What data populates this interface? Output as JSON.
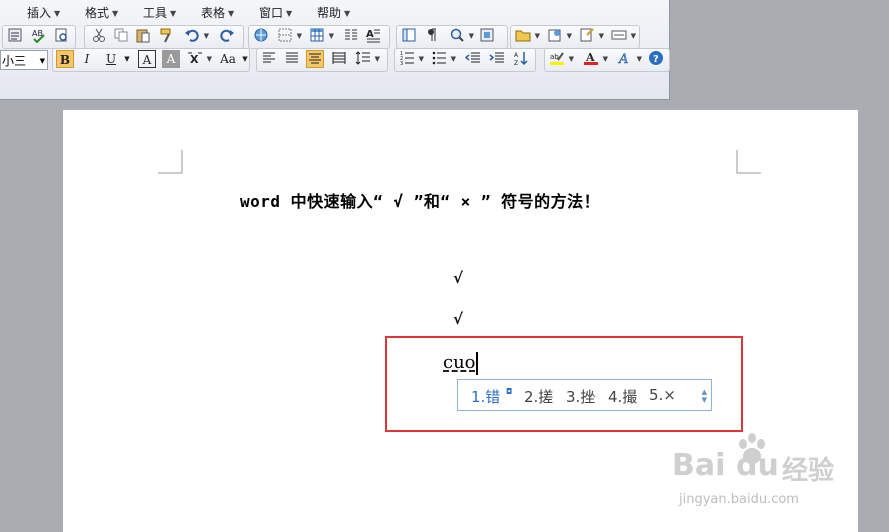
{
  "menubar": {
    "items": [
      {
        "label": "插入"
      },
      {
        "label": "格式"
      },
      {
        "label": "工具"
      },
      {
        "label": "表格"
      },
      {
        "label": "窗口"
      },
      {
        "label": "帮助"
      }
    ]
  },
  "toolbar": {
    "font_size": "小三",
    "bold": "B",
    "italic": "I",
    "underline": "U",
    "char_border": "A",
    "char_shading": "A",
    "change_case": "Aa",
    "bold_active": true
  },
  "document": {
    "heading": "word 中快速输入“ √ ”和“ × ”  符号的方法！",
    "check_mark_1": "√",
    "check_mark_2": "√",
    "typed_text": "cuo"
  },
  "ime": {
    "candidates": [
      {
        "label": "1.错",
        "selected": true
      },
      {
        "label": "2.搓",
        "selected": false
      },
      {
        "label": "3.挫",
        "selected": false
      },
      {
        "label": "4.撮",
        "selected": false
      },
      {
        "label": "5.×",
        "selected": false
      }
    ]
  },
  "watermark": {
    "brand": "Bai",
    "brand2": "du",
    "brand_cn": "经验",
    "url": "jingyan.baidu.com"
  },
  "colors": {
    "highlight_border": "#e0343c",
    "selected_candidate": "#2c6fc4",
    "active_button": "#f6c76a",
    "workspace": "#a9acb1"
  }
}
